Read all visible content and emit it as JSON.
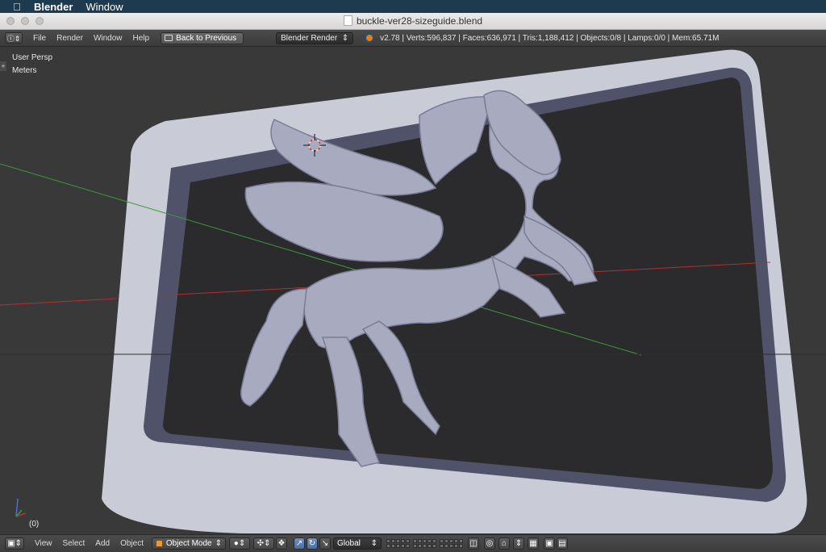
{
  "mac_menubar": {
    "apple_icon": "apple-icon",
    "app_name": "Blender",
    "items": [
      "Window"
    ]
  },
  "window": {
    "title": "buckle-ver28-sizeguide.blend"
  },
  "info_header": {
    "menus": [
      "File",
      "Render",
      "Window",
      "Help"
    ],
    "back_button": "Back to Previous",
    "render_engine": "Blender Render",
    "stats": "v2.78 | Verts:596,837 | Faces:636,971 | Tris:1,188,412 | Objects:0/8 | Lamps:0/0 | Mem:65.71M"
  },
  "viewport": {
    "view_name": "User Persp",
    "units": "Meters",
    "frame": "(0)",
    "colors": {
      "background": "#393939",
      "frame": "#c9cbd6",
      "inner": "#2b2b2d",
      "model": "#a8aac0",
      "x_axis": "#b03030",
      "y_axis": "#3c9a3c"
    }
  },
  "bottom_header": {
    "menus": [
      "View",
      "Select",
      "Add",
      "Object"
    ],
    "mode": "Object Mode",
    "orientation": "Global"
  }
}
